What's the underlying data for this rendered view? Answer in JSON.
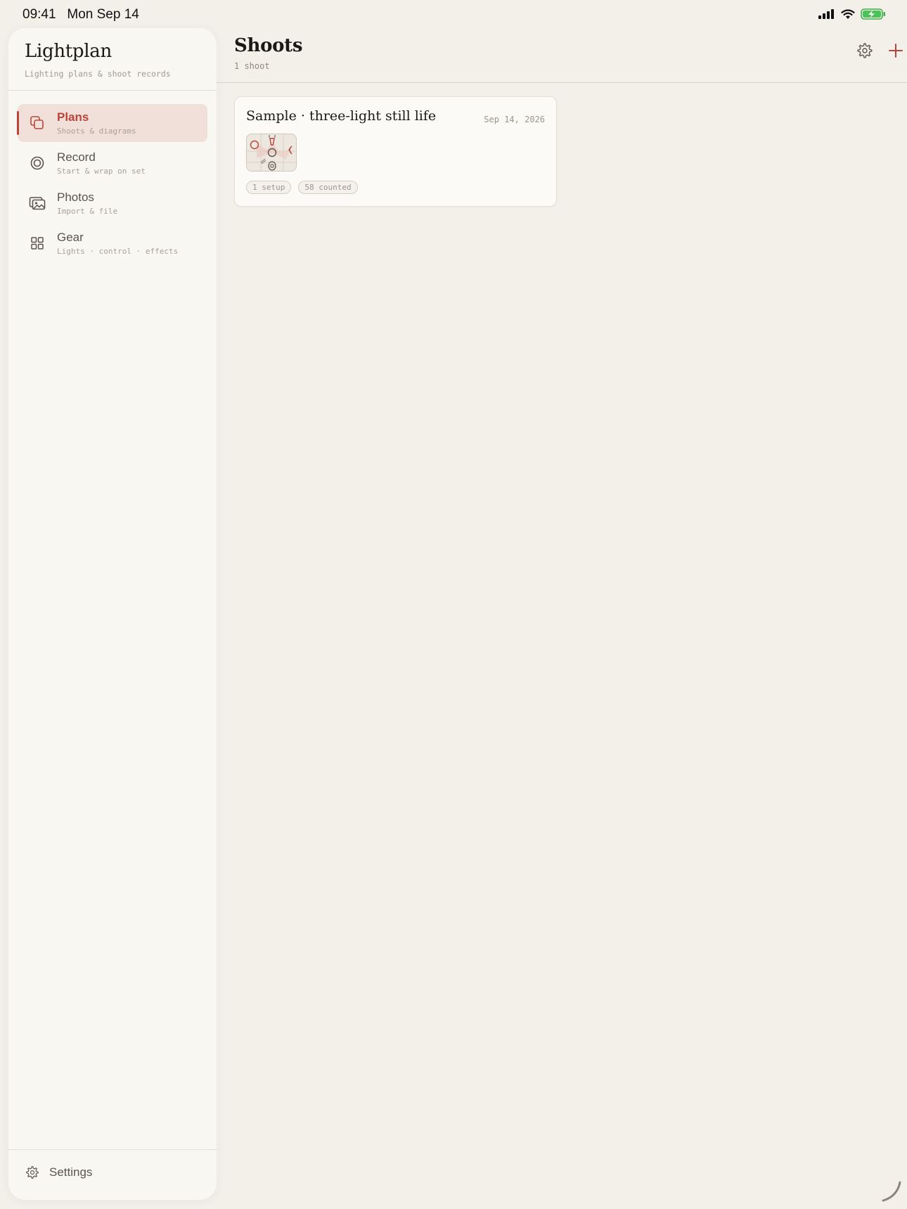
{
  "status_bar": {
    "time": "09:41",
    "date": "Mon Sep 14",
    "icons": [
      "signal-icon",
      "wifi-icon",
      "battery-charging-icon"
    ]
  },
  "sidebar": {
    "app_title": "Lightplan",
    "app_subtitle": "Lighting plans & shoot records",
    "items": [
      {
        "label": "Plans",
        "subtitle": "Shoots & diagrams",
        "icon": "plans-icon",
        "active": true
      },
      {
        "label": "Record",
        "subtitle": "Start & wrap on set",
        "icon": "record-icon",
        "active": false
      },
      {
        "label": "Photos",
        "subtitle": "Import & file",
        "icon": "photos-icon",
        "active": false
      },
      {
        "label": "Gear",
        "subtitle": "Lights · control · effects",
        "icon": "grid-icon",
        "active": false
      }
    ],
    "footer": {
      "label": "Settings",
      "icon": "gear-icon"
    }
  },
  "main": {
    "title": "Shoots",
    "count": "1 shoot",
    "actions": [
      {
        "name": "settings",
        "icon": "gear-icon"
      },
      {
        "name": "add",
        "icon": "plus-icon"
      }
    ],
    "shoots": [
      {
        "title": "Sample · three-light still life",
        "date": "Sep 14, 2026",
        "thumbnail": "lighting-diagram-thumbnail",
        "tags": [
          "1 setup",
          "58 counted"
        ]
      }
    ]
  },
  "colors": {
    "background": "#f3f0ea",
    "sidebar": "#f9f7f2",
    "accent": "#b9443a",
    "active_bg": "#f1e0da",
    "text": "#1c1815",
    "muted": "#a19a91"
  }
}
